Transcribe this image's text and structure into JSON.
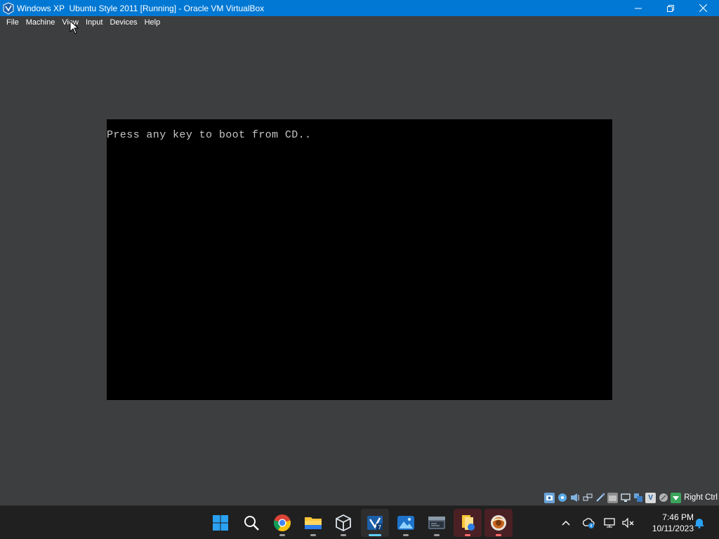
{
  "window": {
    "title": "Windows XP  Ubuntu Style 2011 [Running] - Oracle VM VirtualBox",
    "controls": [
      "minimize-icon",
      "maximize-icon",
      "close-icon"
    ]
  },
  "menu": {
    "items": [
      {
        "label": "File"
      },
      {
        "label": "Machine"
      },
      {
        "label": "View"
      },
      {
        "label": "Input"
      },
      {
        "label": "Devices"
      },
      {
        "label": "Help"
      }
    ]
  },
  "vm": {
    "console_text": "Press any key to boot from CD.."
  },
  "statusbar": {
    "icons": [
      "hard-disk-icon",
      "optical-drive-icon",
      "audio-icon",
      "network-icon",
      "usb-icon",
      "shared-folders-icon",
      "display-icon",
      "video-capture-icon",
      "virtualization-icon",
      "mouse-integration-icon",
      "keyboard-capture-icon"
    ],
    "host_key": "Right Ctrl"
  },
  "taskbar": {
    "apps": [
      "start-icon",
      "search-icon",
      "chrome-icon",
      "file-explorer-icon",
      "virtualbox-icon",
      "virtualbox-vm-icon",
      "photos-icon",
      "terminal-icon",
      "file-manager-icon",
      "media-player-icon"
    ],
    "tray": [
      "show-hidden-icons-icon",
      "onedrive-icon",
      "network-icon",
      "volume-muted-icon"
    ],
    "clock_time": "7:46 PM",
    "clock_date": "10/11/2023",
    "notification": "notification-bell-icon"
  },
  "colors": {
    "titlebar": "#0078d4",
    "background": "#3d3e40",
    "vm_screen": "#000000",
    "taskbar": "#202020",
    "accent": "#60cdff"
  }
}
